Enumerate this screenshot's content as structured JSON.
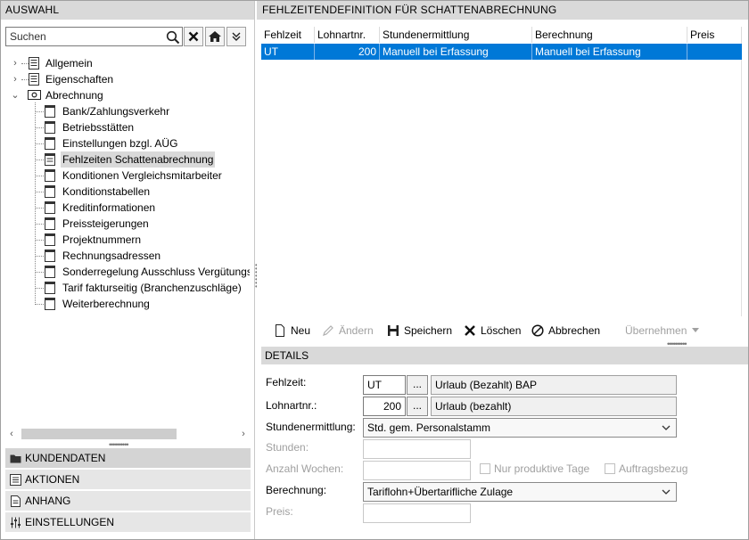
{
  "left": {
    "header": "AUSWAHL",
    "search": {
      "placeholder": "Suchen",
      "value": ""
    },
    "tree": {
      "roots": [
        {
          "label": "Allgemein"
        },
        {
          "label": "Eigenschaften"
        },
        {
          "label": "Abrechnung"
        }
      ],
      "children": [
        {
          "label": "Bank/Zahlungsverkehr"
        },
        {
          "label": "Betriebsstätten"
        },
        {
          "label": "Einstellungen bzgl. AÜG"
        },
        {
          "label": "Fehlzeiten Schattenabrechnung"
        },
        {
          "label": "Konditionen Vergleichsmitarbeiter"
        },
        {
          "label": "Konditionstabellen"
        },
        {
          "label": "Kreditinformationen"
        },
        {
          "label": "Preissteigerungen"
        },
        {
          "label": "Projektnummern"
        },
        {
          "label": "Rechnungsadressen"
        },
        {
          "label": "Sonderregelung Ausschluss Vergütungsl"
        },
        {
          "label": "Tarif fakturseitig (Branchenzuschläge)"
        },
        {
          "label": "Weiterberechnung"
        }
      ]
    },
    "nav": [
      {
        "label": "KUNDENDATEN"
      },
      {
        "label": "AKTIONEN"
      },
      {
        "label": "ANHANG"
      },
      {
        "label": "EINSTELLUNGEN"
      }
    ]
  },
  "right": {
    "header": "FEHLZEITENDEFINITION FÜR SCHATTENABRECHNUNG",
    "grid": {
      "columns": [
        "Fehlzeit",
        "Lohnartnr.",
        "Stundenermittlung",
        "Berechnung",
        "Preis"
      ],
      "rows": [
        {
          "fehlzeit": "UT",
          "lohnartnr": "200",
          "stundenermittlung": "Manuell bei Erfassung",
          "berechnung": "Manuell bei Erfassung",
          "preis": ""
        }
      ]
    },
    "toolbar": {
      "neu": "Neu",
      "aendern": "Ändern",
      "speichern": "Speichern",
      "loeschen": "Löschen",
      "abbrechen": "Abbrechen",
      "uebernehmen": "Übernehmen"
    },
    "details": {
      "header": "DETAILS",
      "fehlzeit_label": "Fehlzeit:",
      "fehlzeit_value": "UT",
      "fehlzeit_desc": "Urlaub (Bezahlt) BAP",
      "lohnart_label": "Lohnartnr.:",
      "lohnart_value": "200",
      "lohnart_desc": "Urlaub (bezahlt)",
      "stundenermittlung_label": "Stundenermittlung:",
      "stundenermittlung_value": "Std. gem. Personalstamm",
      "stunden_label": "Stunden:",
      "anzahl_wochen_label": "Anzahl Wochen:",
      "nur_produktive_tage": "Nur produktive Tage",
      "auftragsbezug": "Auftragsbezug",
      "berechnung_label": "Berechnung:",
      "berechnung_value": "Tariflohn+Übertarifliche Zulage",
      "preis_label": "Preis:",
      "dots": "..."
    }
  }
}
